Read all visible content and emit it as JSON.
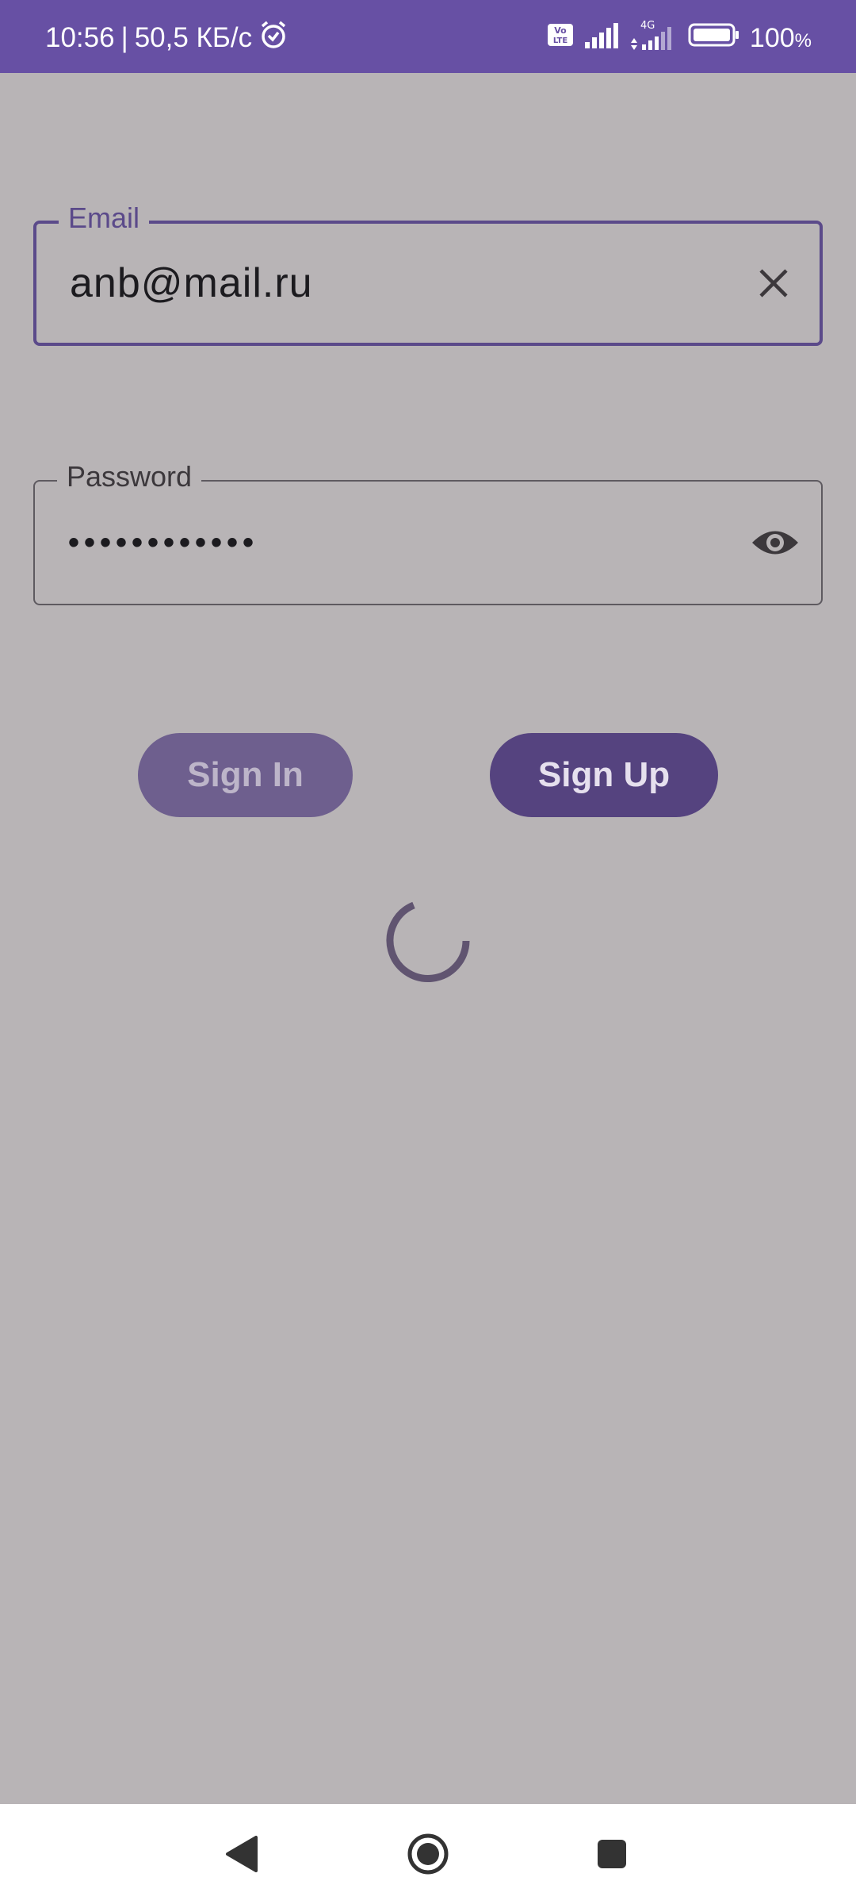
{
  "status_bar": {
    "time": "10:56",
    "separator": "|",
    "speed": "50,5 КБ/с",
    "alarm_icon": "alarm-clock-icon",
    "volte_icon": "volte-icon",
    "network_type": "4G",
    "battery_percent": "100",
    "battery_unit": "%"
  },
  "form": {
    "email": {
      "label": "Email",
      "value": "anb@mail.ru",
      "trailing_icon": "clear-icon"
    },
    "password": {
      "label": "Password",
      "value": "••••••••••••",
      "trailing_icon": "eye-icon"
    }
  },
  "buttons": {
    "sign_in": "Sign In",
    "sign_up": "Sign Up"
  },
  "loading": {
    "icon": "progress-spinner-icon"
  },
  "nav_bar": {
    "back_icon": "back-triangle-icon",
    "home_icon": "home-circle-icon",
    "recents_icon": "recents-square-icon"
  },
  "colors": {
    "status_bar": "#6750a4",
    "background": "#b8b4b6",
    "accent": "#5b4a8a",
    "sign_in_button": "#6e5f8e",
    "sign_up_button": "#55437f"
  }
}
